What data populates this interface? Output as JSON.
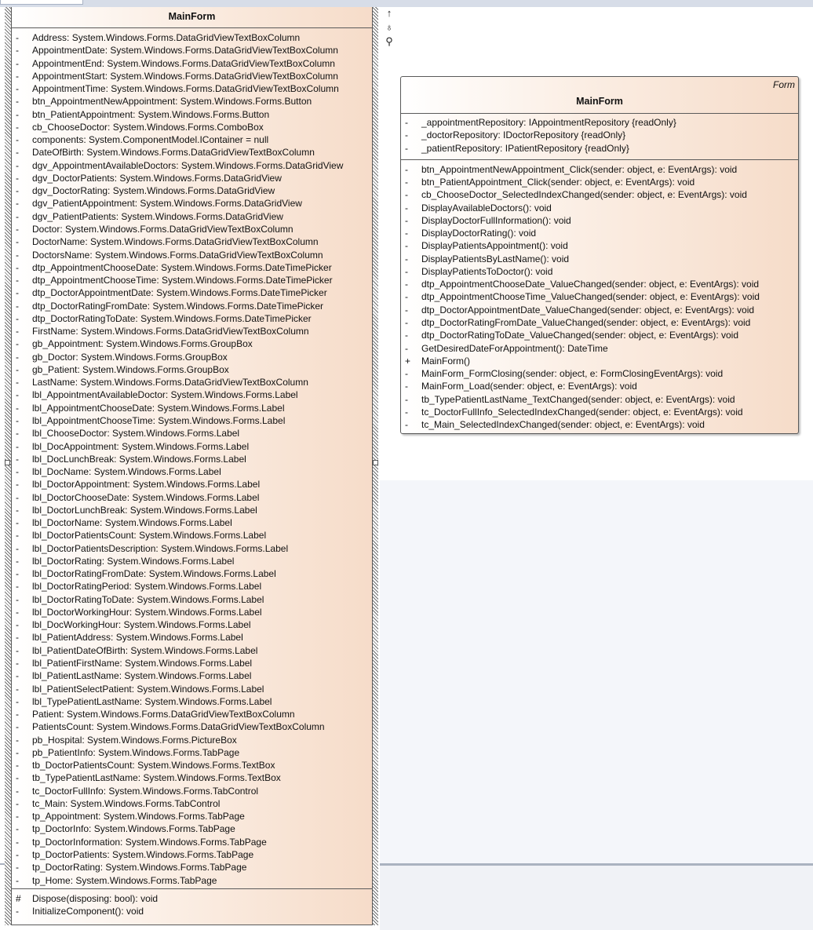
{
  "left_class": {
    "name": "MainForm",
    "attributes": [
      {
        "vis": "-",
        "text": "Address: System.Windows.Forms.DataGridViewTextBoxColumn"
      },
      {
        "vis": "-",
        "text": "AppointmentDate: System.Windows.Forms.DataGridViewTextBoxColumn"
      },
      {
        "vis": "-",
        "text": "AppointmentEnd: System.Windows.Forms.DataGridViewTextBoxColumn"
      },
      {
        "vis": "-",
        "text": "AppointmentStart: System.Windows.Forms.DataGridViewTextBoxColumn"
      },
      {
        "vis": "-",
        "text": "AppointmentTime: System.Windows.Forms.DataGridViewTextBoxColumn"
      },
      {
        "vis": "-",
        "text": "btn_AppointmentNewAppointment: System.Windows.Forms.Button"
      },
      {
        "vis": "-",
        "text": "btn_PatientAppointment: System.Windows.Forms.Button"
      },
      {
        "vis": "-",
        "text": "cb_ChooseDoctor: System.Windows.Forms.ComboBox"
      },
      {
        "vis": "-",
        "text": "components: System.ComponentModel.IContainer = null"
      },
      {
        "vis": "-",
        "text": "DateOfBirth: System.Windows.Forms.DataGridViewTextBoxColumn"
      },
      {
        "vis": "-",
        "text": "dgv_AppointmentAvailableDoctors: System.Windows.Forms.DataGridView"
      },
      {
        "vis": "-",
        "text": "dgv_DoctorPatients: System.Windows.Forms.DataGridView"
      },
      {
        "vis": "-",
        "text": "dgv_DoctorRating: System.Windows.Forms.DataGridView"
      },
      {
        "vis": "-",
        "text": "dgv_PatientAppointment: System.Windows.Forms.DataGridView"
      },
      {
        "vis": "-",
        "text": "dgv_PatientPatients: System.Windows.Forms.DataGridView"
      },
      {
        "vis": "-",
        "text": "Doctor: System.Windows.Forms.DataGridViewTextBoxColumn"
      },
      {
        "vis": "-",
        "text": "DoctorName: System.Windows.Forms.DataGridViewTextBoxColumn"
      },
      {
        "vis": "-",
        "text": "DoctorsName: System.Windows.Forms.DataGridViewTextBoxColumn"
      },
      {
        "vis": "-",
        "text": "dtp_AppointmentChooseDate: System.Windows.Forms.DateTimePicker"
      },
      {
        "vis": "-",
        "text": "dtp_AppointmentChooseTime: System.Windows.Forms.DateTimePicker"
      },
      {
        "vis": "-",
        "text": "dtp_DoctorAppointmentDate: System.Windows.Forms.DateTimePicker"
      },
      {
        "vis": "-",
        "text": "dtp_DoctorRatingFromDate: System.Windows.Forms.DateTimePicker"
      },
      {
        "vis": "-",
        "text": "dtp_DoctorRatingToDate: System.Windows.Forms.DateTimePicker"
      },
      {
        "vis": "-",
        "text": "FirstName: System.Windows.Forms.DataGridViewTextBoxColumn"
      },
      {
        "vis": "-",
        "text": "gb_Appointment: System.Windows.Forms.GroupBox"
      },
      {
        "vis": "-",
        "text": "gb_Doctor: System.Windows.Forms.GroupBox"
      },
      {
        "vis": "-",
        "text": "gb_Patient: System.Windows.Forms.GroupBox"
      },
      {
        "vis": "-",
        "text": "LastName: System.Windows.Forms.DataGridViewTextBoxColumn"
      },
      {
        "vis": "-",
        "text": "lbl_AppointmentAvailableDoctor: System.Windows.Forms.Label"
      },
      {
        "vis": "-",
        "text": "lbl_AppointmentChooseDate: System.Windows.Forms.Label"
      },
      {
        "vis": "-",
        "text": "lbl_AppointmentChooseTime: System.Windows.Forms.Label"
      },
      {
        "vis": "-",
        "text": "lbl_ChooseDoctor: System.Windows.Forms.Label"
      },
      {
        "vis": "-",
        "text": "lbl_DocAppointment: System.Windows.Forms.Label"
      },
      {
        "vis": "-",
        "text": "lbl_DocLunchBreak: System.Windows.Forms.Label"
      },
      {
        "vis": "-",
        "text": "lbl_DocName: System.Windows.Forms.Label"
      },
      {
        "vis": "-",
        "text": "lbl_DoctorAppointment: System.Windows.Forms.Label"
      },
      {
        "vis": "-",
        "text": "lbl_DoctorChooseDate: System.Windows.Forms.Label"
      },
      {
        "vis": "-",
        "text": "lbl_DoctorLunchBreak: System.Windows.Forms.Label"
      },
      {
        "vis": "-",
        "text": "lbl_DoctorName: System.Windows.Forms.Label"
      },
      {
        "vis": "-",
        "text": "lbl_DoctorPatientsCount: System.Windows.Forms.Label"
      },
      {
        "vis": "-",
        "text": "lbl_DoctorPatientsDescription: System.Windows.Forms.Label"
      },
      {
        "vis": "-",
        "text": "lbl_DoctorRating: System.Windows.Forms.Label"
      },
      {
        "vis": "-",
        "text": "lbl_DoctorRatingFromDate: System.Windows.Forms.Label"
      },
      {
        "vis": "-",
        "text": "lbl_DoctorRatingPeriod: System.Windows.Forms.Label"
      },
      {
        "vis": "-",
        "text": "lbl_DoctorRatingToDate: System.Windows.Forms.Label"
      },
      {
        "vis": "-",
        "text": "lbl_DoctorWorkingHour: System.Windows.Forms.Label"
      },
      {
        "vis": "-",
        "text": "lbl_DocWorkingHour: System.Windows.Forms.Label"
      },
      {
        "vis": "-",
        "text": "lbl_PatientAddress: System.Windows.Forms.Label"
      },
      {
        "vis": "-",
        "text": "lbl_PatientDateOfBirth: System.Windows.Forms.Label"
      },
      {
        "vis": "-",
        "text": "lbl_PatientFirstName: System.Windows.Forms.Label"
      },
      {
        "vis": "-",
        "text": "lbl_PatientLastName: System.Windows.Forms.Label"
      },
      {
        "vis": "-",
        "text": "lbl_PatientSelectPatient: System.Windows.Forms.Label"
      },
      {
        "vis": "-",
        "text": "lbl_TypePatientLastName: System.Windows.Forms.Label"
      },
      {
        "vis": "-",
        "text": "Patient: System.Windows.Forms.DataGridViewTextBoxColumn"
      },
      {
        "vis": "-",
        "text": "PatientsCount: System.Windows.Forms.DataGridViewTextBoxColumn"
      },
      {
        "vis": "-",
        "text": "pb_Hospital: System.Windows.Forms.PictureBox"
      },
      {
        "vis": "-",
        "text": "pb_PatientInfo: System.Windows.Forms.TabPage"
      },
      {
        "vis": "-",
        "text": "tb_DoctorPatientsCount: System.Windows.Forms.TextBox"
      },
      {
        "vis": "-",
        "text": "tb_TypePatientLastName: System.Windows.Forms.TextBox"
      },
      {
        "vis": "-",
        "text": "tc_DoctorFullInfo: System.Windows.Forms.TabControl"
      },
      {
        "vis": "-",
        "text": "tc_Main: System.Windows.Forms.TabControl"
      },
      {
        "vis": "-",
        "text": "tp_Appointment: System.Windows.Forms.TabPage"
      },
      {
        "vis": "-",
        "text": "tp_DoctorInfo: System.Windows.Forms.TabPage"
      },
      {
        "vis": "-",
        "text": "tp_DoctorInformation: System.Windows.Forms.TabPage"
      },
      {
        "vis": "-",
        "text": "tp_DoctorPatients: System.Windows.Forms.TabPage"
      },
      {
        "vis": "-",
        "text": "tp_DoctorRating: System.Windows.Forms.TabPage"
      },
      {
        "vis": "-",
        "text": "tp_Home: System.Windows.Forms.TabPage"
      }
    ],
    "operations": [
      {
        "vis": "#",
        "text": "Dispose(disposing: bool): void"
      },
      {
        "vis": "-",
        "text": "InitializeComponent(): void"
      }
    ]
  },
  "right_class": {
    "stereotype": "Form",
    "name": "MainForm",
    "attributes": [
      {
        "vis": "-",
        "text": "_appointmentRepository: IAppointmentRepository {readOnly}"
      },
      {
        "vis": "-",
        "text": "_doctorRepository: IDoctorRepository {readOnly}"
      },
      {
        "vis": "-",
        "text": "_patientRepository: IPatientRepository {readOnly}"
      }
    ],
    "operations": [
      {
        "vis": "-",
        "text": "btn_AppointmentNewAppointment_Click(sender: object, e: EventArgs): void"
      },
      {
        "vis": "-",
        "text": "btn_PatientAppointment_Click(sender: object, e: EventArgs): void"
      },
      {
        "vis": "-",
        "text": "cb_ChooseDoctor_SelectedIndexChanged(sender: object, e: EventArgs): void"
      },
      {
        "vis": "-",
        "text": "DisplayAvailableDoctors(): void"
      },
      {
        "vis": "-",
        "text": "DisplayDoctorFullInformation(): void"
      },
      {
        "vis": "-",
        "text": "DisplayDoctorRating(): void"
      },
      {
        "vis": "-",
        "text": "DisplayPatientsAppointment(): void"
      },
      {
        "vis": "-",
        "text": "DisplayPatientsByLastName(): void"
      },
      {
        "vis": "-",
        "text": "DisplayPatientsToDoctor(): void"
      },
      {
        "vis": "-",
        "text": "dtp_AppointmentChooseDate_ValueChanged(sender: object, e: EventArgs): void"
      },
      {
        "vis": "-",
        "text": "dtp_AppointmentChooseTime_ValueChanged(sender: object, e: EventArgs): void"
      },
      {
        "vis": "-",
        "text": "dtp_DoctorAppointmentDate_ValueChanged(sender: object, e: EventArgs): void"
      },
      {
        "vis": "-",
        "text": "dtp_DoctorRatingFromDate_ValueChanged(sender: object, e: EventArgs): void"
      },
      {
        "vis": "-",
        "text": "dtp_DoctorRatingToDate_ValueChanged(sender: object, e: EventArgs): void"
      },
      {
        "vis": "-",
        "text": "GetDesiredDateForAppointment(): DateTime"
      },
      {
        "vis": "+",
        "text": "MainForm()"
      },
      {
        "vis": "-",
        "text": "MainForm_FormClosing(sender: object, e: FormClosingEventArgs): void"
      },
      {
        "vis": "-",
        "text": "MainForm_Load(sender: object, e: EventArgs): void"
      },
      {
        "vis": "-",
        "text": "tb_TypePatientLastName_TextChanged(sender: object, e: EventArgs): void"
      },
      {
        "vis": "-",
        "text": "tc_DoctorFullInfo_SelectedIndexChanged(sender: object, e: EventArgs): void"
      },
      {
        "vis": "-",
        "text": "tc_Main_SelectedIndexChanged(sender: object, e: EventArgs): void"
      }
    ]
  },
  "toolbar": {
    "icons": [
      "arrow-up-icon",
      "link-connector-icon",
      "magnifier-icon"
    ],
    "glyphs": [
      "↑",
      "♁",
      "⚲"
    ]
  },
  "colors": {
    "class_fill_end": "#f6dcc9",
    "class_border": "#5a5a5a"
  }
}
